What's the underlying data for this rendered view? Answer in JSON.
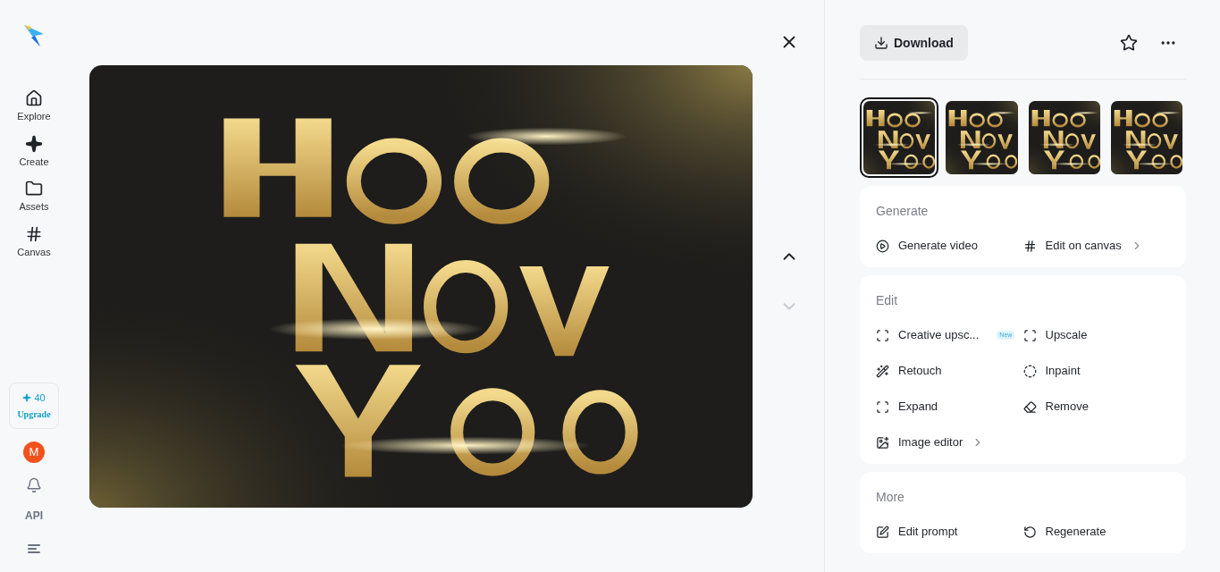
{
  "sidebar": {
    "nav": [
      {
        "label": "Explore",
        "selected": false
      },
      {
        "label": "Create",
        "selected": false
      },
      {
        "label": "Assets",
        "selected": false
      },
      {
        "label": "Canvas",
        "selected": false
      }
    ],
    "credits": {
      "count": "40",
      "action": "Upgrade"
    },
    "avatar": "M",
    "api": "API"
  },
  "viewer": {
    "image": {
      "kind": "picture"
    },
    "prev_disabled": false,
    "next_disabled": true
  },
  "panel": {
    "download": "Download",
    "thumbnails": [
      {
        "kind": "picture",
        "selected": true
      },
      {
        "kind": "picture",
        "selected": false
      },
      {
        "kind": "picture",
        "selected": false
      },
      {
        "kind": "picture",
        "selected": false
      }
    ],
    "sections": [
      {
        "title": "Generate",
        "items": [
          {
            "label": "Generate video",
            "submenu": false
          },
          {
            "label": "Edit on canvas",
            "submenu": true
          }
        ]
      },
      {
        "title": "Edit",
        "items": [
          {
            "label": "Creative upsc...",
            "badge": "New",
            "submenu": false
          },
          {
            "label": "Upscale",
            "submenu": false
          },
          {
            "label": "Retouch",
            "submenu": false
          },
          {
            "label": "Inpaint",
            "submenu": false
          },
          {
            "label": "Expand",
            "submenu": false
          },
          {
            "label": "Remove",
            "submenu": false
          },
          {
            "label": "Image editor",
            "submenu": true
          }
        ]
      },
      {
        "title": "More",
        "items": [
          {
            "label": "Edit prompt",
            "submenu": false
          },
          {
            "label": "Regenerate",
            "submenu": false
          }
        ]
      }
    ]
  }
}
